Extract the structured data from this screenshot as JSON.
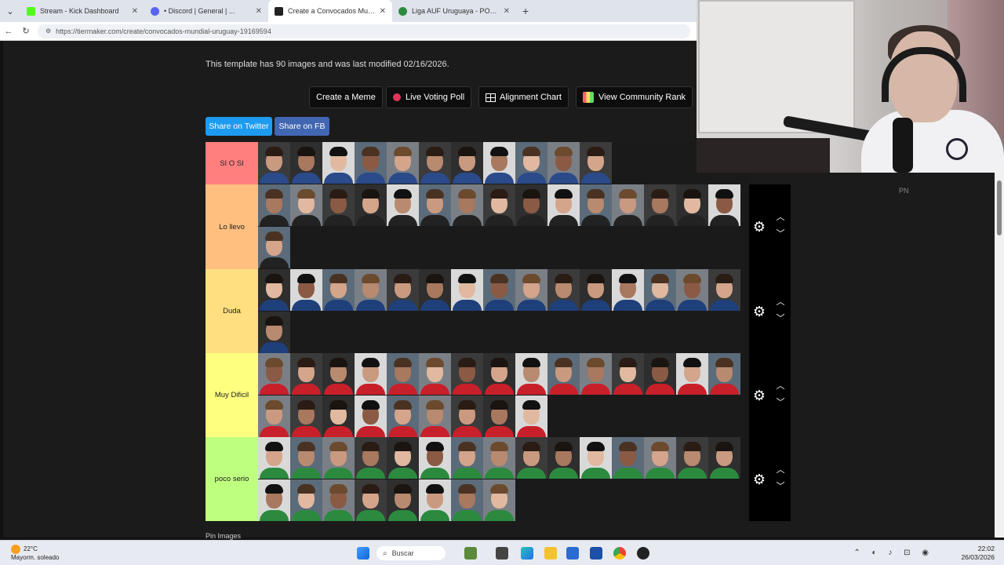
{
  "browser": {
    "tabs": [
      {
        "title": "Stream - Kick Dashboard",
        "color": "#53fc18",
        "active": false
      },
      {
        "title": "• Discord | General | ...",
        "color": "#5865f2",
        "active": false
      },
      {
        "title": "Create a Convocados Mundial Uru...",
        "color": "#222222",
        "active": true
      },
      {
        "title": "Liga AUF Uruguaya - POSICIONES",
        "color": "#2c8a3c",
        "active": false
      }
    ],
    "new_tab": "+",
    "url": "https://tiermaker.com/create/convocados-mundial-uruguay-19169594"
  },
  "page": {
    "template_info": "This template has 90 images and was last modified 02/16/2026.",
    "buttons": {
      "meme": "Create a Meme",
      "poll": "Live Voting Poll",
      "alignment": "Alignment Chart",
      "community": "View Community Rank"
    },
    "share_twitter": "Share on Twitter",
    "share_fb": "Share on FB",
    "bottom_peek": "Pin Images"
  },
  "tiers": [
    {
      "label": "SI O SI",
      "color": "#ff7f7f",
      "count": 11
    },
    {
      "label": "Lo llevo",
      "color": "#ffbf7f",
      "count": 16
    },
    {
      "label": "Duda",
      "color": "#ffdf7f",
      "count": 16
    },
    {
      "label": "Muy Dificil",
      "color": "#ffff7f",
      "count": 24
    },
    {
      "label": "poco serio",
      "color": "#bfff7f",
      "count": 23
    }
  ],
  "webcam": {
    "overlay_label": "PN"
  },
  "taskbar": {
    "temperature": "22°C",
    "weather": "Mayorm. soleado",
    "search": "Buscar",
    "time": "22:02",
    "date": "26/03/2026"
  }
}
